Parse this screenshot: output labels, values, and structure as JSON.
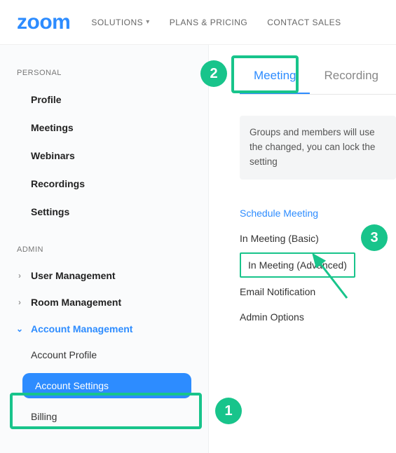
{
  "header": {
    "logo": "zoom",
    "nav": {
      "solutions": "SOLUTIONS",
      "plans": "PLANS & PRICING",
      "contact": "CONTACT SALES"
    }
  },
  "sidebar": {
    "personal_label": "PERSONAL",
    "personal": {
      "profile": "Profile",
      "meetings": "Meetings",
      "webinars": "Webinars",
      "recordings": "Recordings",
      "settings": "Settings"
    },
    "admin_label": "ADMIN",
    "admin": {
      "user_mgmt": "User Management",
      "room_mgmt": "Room Management",
      "acct_mgmt": "Account Management",
      "sub": {
        "acct_profile": "Account Profile",
        "acct_settings": "Account Settings",
        "billing": "Billing"
      }
    }
  },
  "content": {
    "tabs": {
      "meeting": "Meeting",
      "recording": "Recording"
    },
    "banner": "Groups and members will use the changed, you can lock the setting",
    "links": {
      "schedule": "Schedule Meeting",
      "basic": "In Meeting (Basic)",
      "advanced": "In Meeting (Advanced)",
      "email": "Email Notification",
      "admin": "Admin Options"
    }
  },
  "annotations": {
    "n1": "1",
    "n2": "2",
    "n3": "3"
  }
}
